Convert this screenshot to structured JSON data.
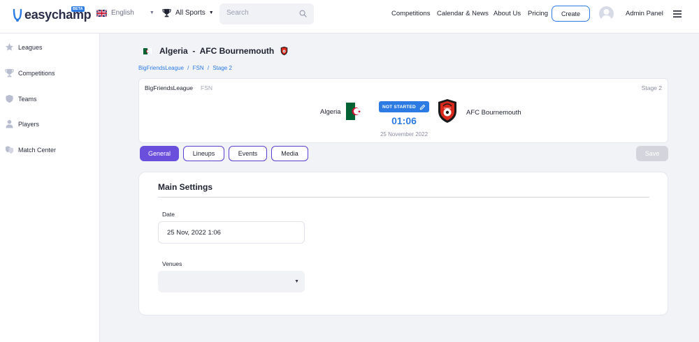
{
  "header": {
    "logo_text": "easychamp",
    "beta_label": "BETA",
    "language": "English",
    "sport": "All Sports",
    "search_placeholder": "Search",
    "nav": [
      "Competitions",
      "Calendar & News",
      "About Us",
      "Pricing"
    ],
    "create_label": "Create",
    "admin_label": "Admin Panel"
  },
  "sidebar": {
    "items": [
      {
        "label": "Leagues",
        "icon": "star-icon"
      },
      {
        "label": "Competitions",
        "icon": "trophy-icon"
      },
      {
        "label": "Teams",
        "icon": "shield-icon"
      },
      {
        "label": "Players",
        "icon": "user-icon"
      },
      {
        "label": "Match Center",
        "icon": "shields-icon"
      }
    ]
  },
  "match": {
    "title_home": "Algeria",
    "title_sep": "-",
    "title_away": "AFC Bournemouth",
    "breadcrumb": [
      "BigFriendsLeague",
      "/",
      "FSN",
      "/",
      "Stage 2"
    ],
    "league": "BigFriendsLeague",
    "group": "FSN",
    "stage": "Stage 2",
    "home_team": "Algeria",
    "away_team": "AFC Bournemouth",
    "status": "NOT STARTED",
    "time": "01:06",
    "date": "25 November 2022"
  },
  "tabs": [
    "General",
    "Lineups",
    "Events",
    "Media"
  ],
  "save_label": "Save",
  "settings": {
    "title": "Main Settings",
    "date_label": "Date",
    "date_value": "25 Nov, 2022 1:06",
    "venues_label": "Venues",
    "venues_value": ""
  },
  "colors": {
    "accent": "#2c7be5",
    "tab_accent": "#6a4fdd",
    "algeria_green": "#006233",
    "algeria_red": "#d21034",
    "bournemouth_red": "#da291c"
  }
}
